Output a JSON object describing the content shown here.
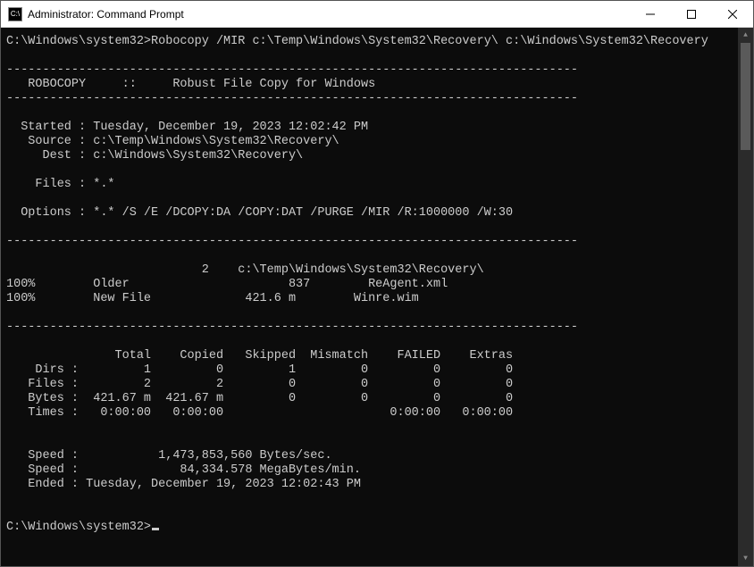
{
  "titlebar": {
    "icon_text": "C:\\",
    "title": "Administrator: Command Prompt"
  },
  "session": {
    "prompt": "C:\\Windows\\system32>",
    "command": "Robocopy /MIR c:\\Temp\\Windows\\System32\\Recovery\\ c:\\Windows\\System32\\Recovery",
    "dashline": "-------------------------------------------------------------------------------",
    "header_app": "   ROBOCOPY     ::     Robust File Copy for Windows",
    "started_line": "  Started : Tuesday, December 19, 2023 12:02:42 PM",
    "source_line": "   Source : c:\\Temp\\Windows\\System32\\Recovery\\",
    "dest_line": "     Dest : c:\\Windows\\System32\\Recovery\\",
    "files_line": "    Files : *.*",
    "options_line": "  Options : *.* /S /E /DCOPY:DA /COPY:DAT /PURGE /MIR /R:1000000 /W:30",
    "dir_listed": "                           2    c:\\Temp\\Windows\\System32\\Recovery\\",
    "file1": "100%        Older                      837        ReAgent.xml",
    "file2": "100%        New File             421.6 m        Winre.wim",
    "stat_header": "               Total    Copied   Skipped  Mismatch    FAILED    Extras",
    "stat_dirs": "    Dirs :         1         0         1         0         0         0",
    "stat_files": "   Files :         2         2         0         0         0         0",
    "stat_bytes": "   Bytes :  421.67 m  421.67 m         0         0         0         0",
    "stat_times": "   Times :   0:00:00   0:00:00                       0:00:00   0:00:00",
    "speed1": "   Speed :           1,473,853,560 Bytes/sec.",
    "speed2": "   Speed :              84,334.578 MegaBytes/min.",
    "ended_line": "   Ended : Tuesday, December 19, 2023 12:02:43 PM",
    "end_prompt": "C:\\Windows\\system32>"
  }
}
